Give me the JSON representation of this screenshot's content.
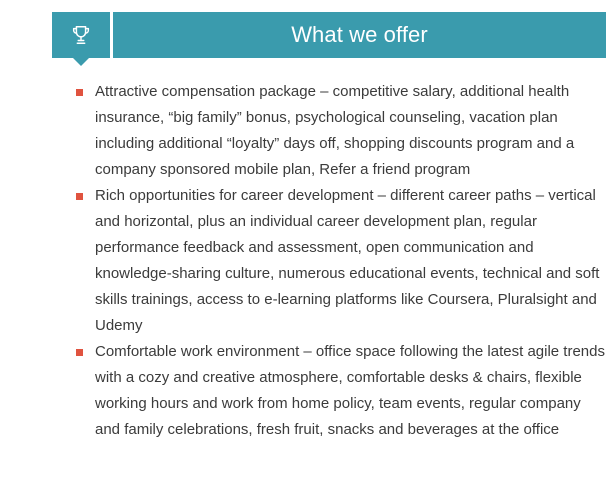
{
  "header": {
    "title": "What we offer",
    "icon": "trophy-icon"
  },
  "colors": {
    "header_bg": "#3a9bad",
    "bullet": "#e0533f",
    "text": "#3b3b3b"
  },
  "offers": [
    {
      "text": "Attractive compensation package – competitive salary, additional health insurance, “big family” bonus, psychological counseling, vacation plan including additional “loyalty” days off, shopping discounts program and a company sponsored mobile plan, Refer a friend program"
    },
    {
      "text": "Rich opportunities for career development – different career paths – vertical and horizontal, plus an individual career development plan, regular performance feedback and assessment, open communication and knowledge-sharing culture, numerous educational events, technical and soft skills trainings, access to e-learning platforms like Coursera, Pluralsight and Udemy"
    },
    {
      "text": "Comfortable work environment – office space following the latest agile trends with a cozy and creative atmosphere, comfortable desks & chairs, flexible working hours and work from home policy, team events, regular company and family celebrations, fresh fruit, snacks and beverages at the office"
    }
  ]
}
